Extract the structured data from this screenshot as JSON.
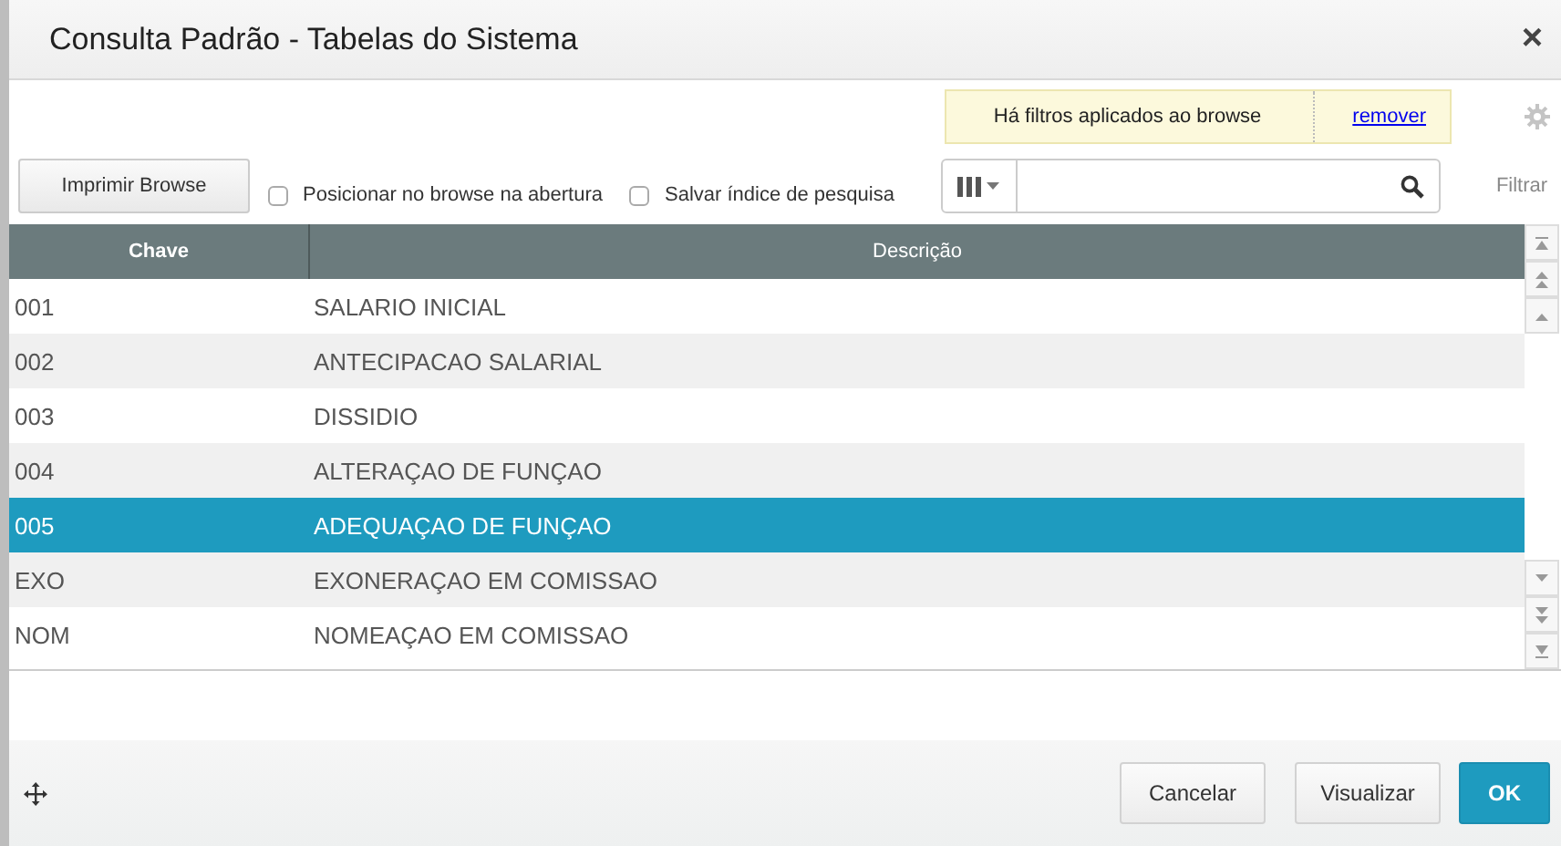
{
  "window": {
    "title": "Consulta Padrão - Tabelas do Sistema",
    "close": "×"
  },
  "filter_notice": {
    "text": "Há filtros aplicados ao browse",
    "link": "remover"
  },
  "toolbar": {
    "print_button": "Imprimir Browse",
    "checkboxes": [
      {
        "label": "Posicionar no browse na abertura",
        "checked": false
      },
      {
        "label": "Salvar índice de pesquisa",
        "checked": false
      }
    ],
    "filter_label": "Filtrar"
  },
  "table": {
    "columns": [
      "Chave",
      "Descrição"
    ],
    "rows": [
      {
        "cells": [
          "001",
          "SALARIO INICIAL"
        ],
        "selected": false
      },
      {
        "cells": [
          "002",
          "ANTECIPACAO SALARIAL"
        ],
        "selected": false
      },
      {
        "cells": [
          "003",
          "DISSIDIO"
        ],
        "selected": false
      },
      {
        "cells": [
          "004",
          "ALTERAÇAO DE FUNÇAO"
        ],
        "selected": false
      },
      {
        "cells": [
          "005",
          "ADEQUAÇAO DE FUNÇAO"
        ],
        "selected": true
      },
      {
        "cells": [
          "EXO",
          "EXONERAÇAO EM COMISSAO"
        ],
        "selected": false
      },
      {
        "cells": [
          "NOM",
          "NOMEAÇAO EM COMISSAO"
        ],
        "selected": false
      }
    ]
  },
  "buttons": [
    {
      "label": "Cancelar",
      "kind": "secondary"
    },
    {
      "label": "Visualizar",
      "kind": "secondary"
    },
    {
      "label": "OK",
      "kind": "primary"
    }
  ]
}
